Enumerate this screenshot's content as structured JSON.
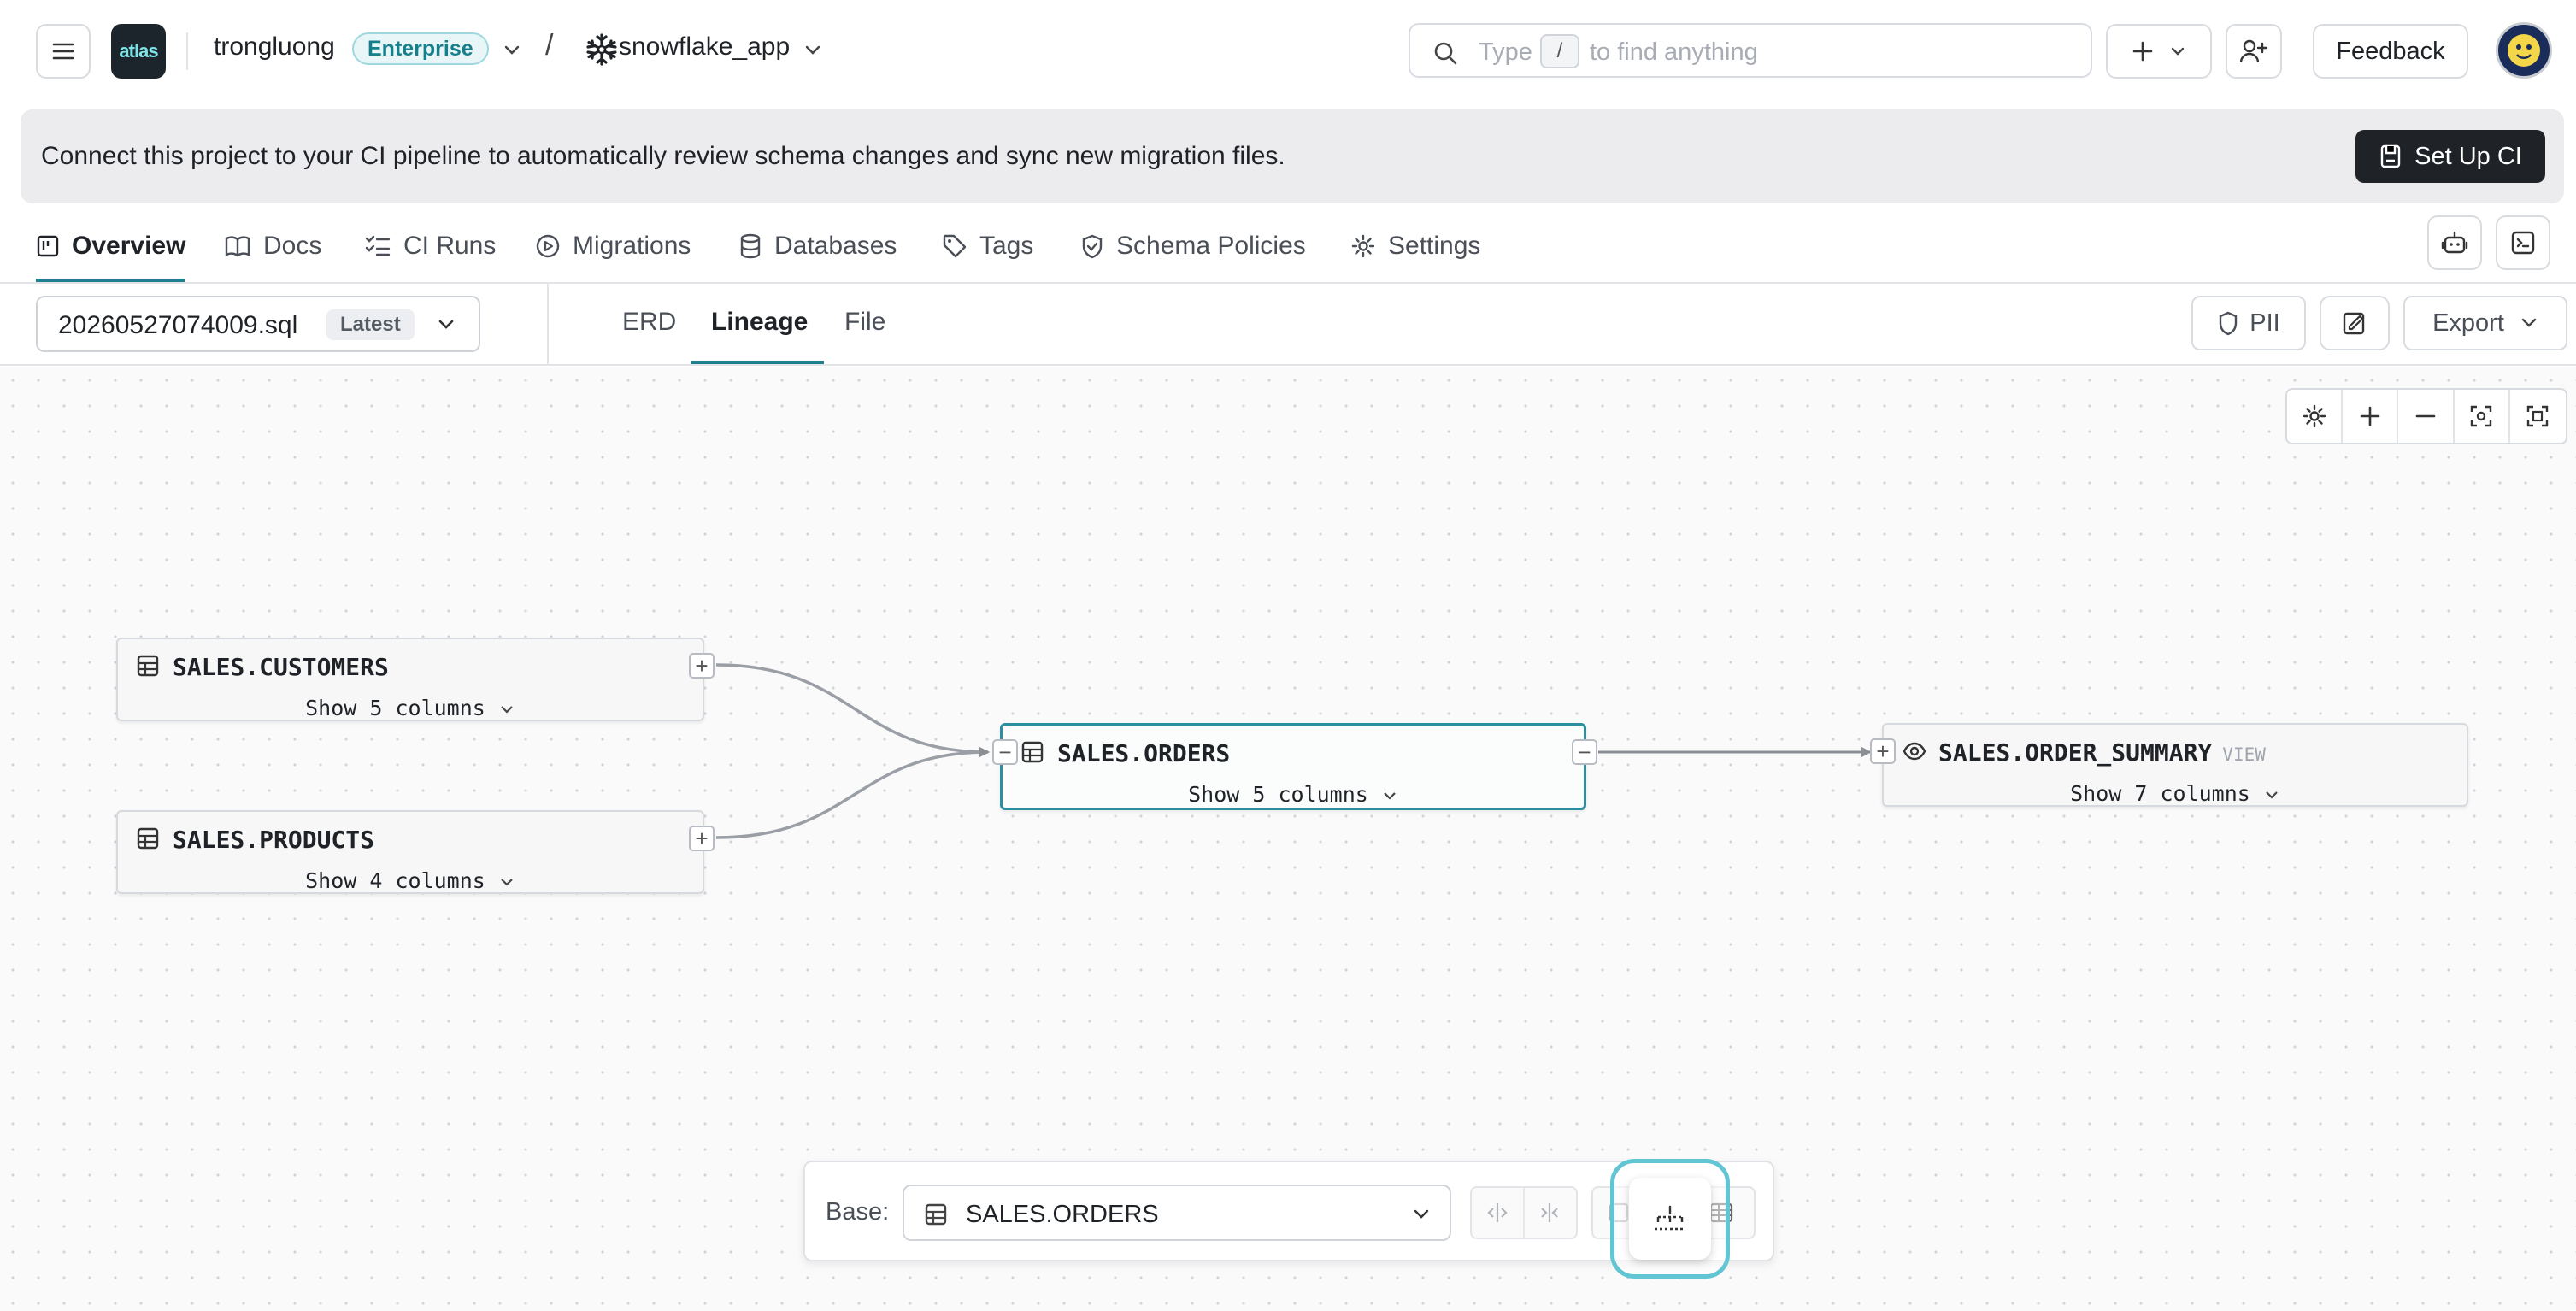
{
  "topbar": {
    "logo_text": "atlas",
    "org_name": "trongluong",
    "plan_badge": "Enterprise",
    "separator": "/",
    "project_name": "snowflake_app",
    "search": {
      "prefix": "Type",
      "key": "/",
      "suffix": "to find anything"
    },
    "feedback_label": "Feedback"
  },
  "banner": {
    "message": "Connect this project to your CI pipeline to automatically review schema changes and sync new migration files.",
    "button_label": "Set Up CI"
  },
  "tabs": [
    {
      "label": "Overview",
      "icon": "layout-icon",
      "active": true
    },
    {
      "label": "Docs",
      "icon": "book-icon"
    },
    {
      "label": "CI Runs",
      "icon": "list-check-icon"
    },
    {
      "label": "Migrations",
      "icon": "play-circle-icon"
    },
    {
      "label": "Databases",
      "icon": "database-icon"
    },
    {
      "label": "Tags",
      "icon": "tag-icon"
    },
    {
      "label": "Schema Policies",
      "icon": "shield-check-icon"
    },
    {
      "label": "Settings",
      "icon": "gear-icon"
    }
  ],
  "subbar": {
    "file_name": "20260527074009.sql",
    "file_badge": "Latest",
    "view_tabs": [
      "ERD",
      "Lineage",
      "File"
    ],
    "active_view": "Lineage",
    "pii_label": "PII",
    "export_label": "Export"
  },
  "graph": {
    "nodes": [
      {
        "name": "SALES.CUSTOMERS",
        "show": "Show 5 columns",
        "kind": "table"
      },
      {
        "name": "SALES.PRODUCTS",
        "show": "Show 4 columns",
        "kind": "table"
      },
      {
        "name": "SALES.ORDERS",
        "show": "Show 5 columns",
        "kind": "table",
        "selected": true
      },
      {
        "name": "SALES.ORDER_SUMMARY",
        "show": "Show 7 columns",
        "kind": "view",
        "tag": "VIEW"
      }
    ],
    "edges": [
      [
        "SALES.CUSTOMERS",
        "SALES.ORDERS"
      ],
      [
        "SALES.PRODUCTS",
        "SALES.ORDERS"
      ],
      [
        "SALES.ORDERS",
        "SALES.ORDER_SUMMARY"
      ]
    ]
  },
  "bottombar": {
    "base_label": "Base:",
    "base_value": "SALES.ORDERS"
  },
  "colors": {
    "accent": "#1f7f8c",
    "selected_border": "#2b8fa0",
    "focus_ring": "#62c5d4",
    "dark_button": "#1f2328"
  }
}
